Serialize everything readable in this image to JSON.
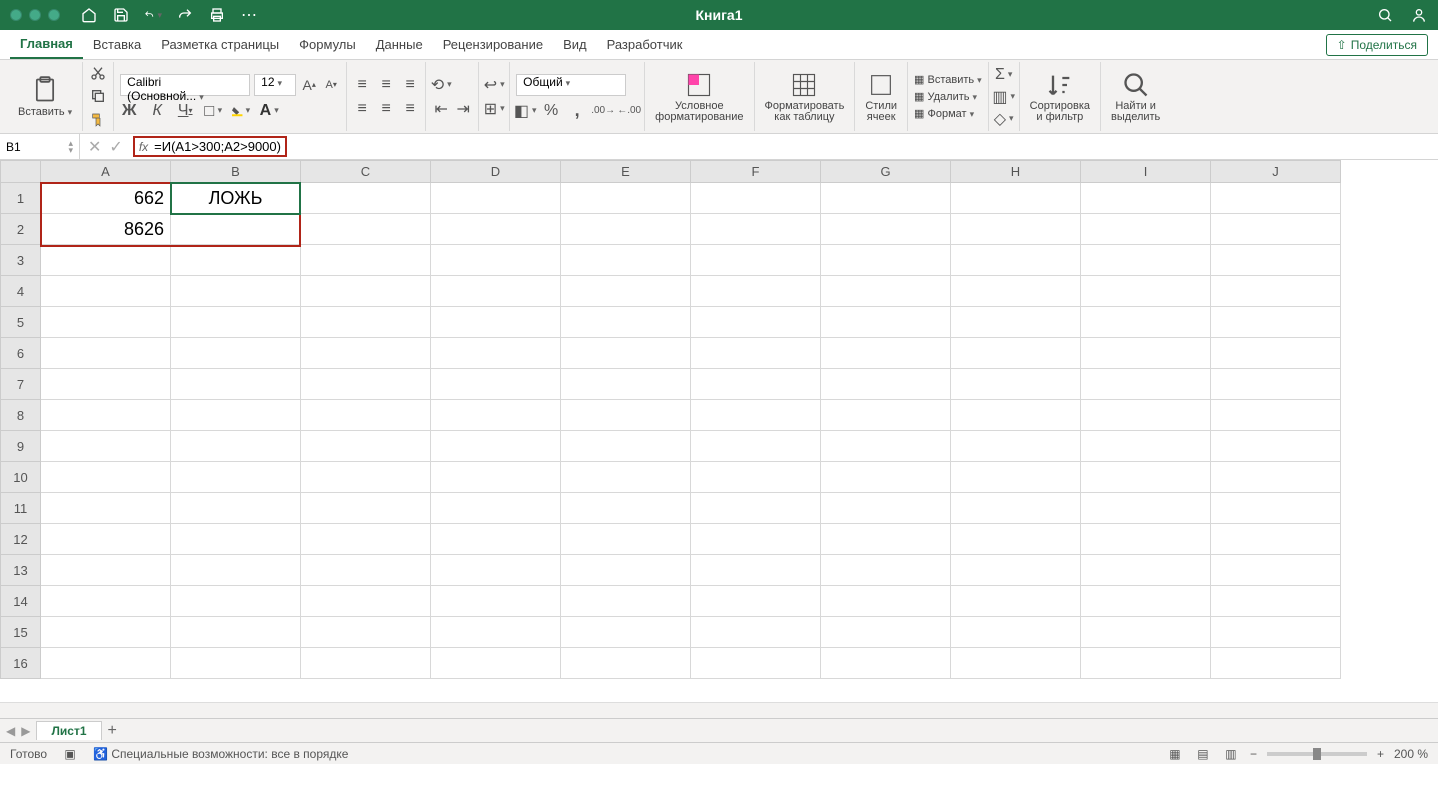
{
  "title": "Книга1",
  "tabs": [
    "Главная",
    "Вставка",
    "Разметка страницы",
    "Формулы",
    "Данные",
    "Рецензирование",
    "Вид",
    "Разработчик"
  ],
  "share": "Поделиться",
  "clipboard": {
    "paste": "Вставить"
  },
  "font": {
    "name": "Calibri (Основной...",
    "size": "12",
    "bold": "Ж",
    "italic": "К",
    "underline": "Ч"
  },
  "number_format": "Общий",
  "cond_fmt": "Условное\nформатирование",
  "fmt_table": "Форматировать\nкак таблицу",
  "cell_styles": "Стили\nячеек",
  "insert": "Вставить",
  "delete": "Удалить",
  "format": "Формат",
  "sort": "Сортировка\nи фильтр",
  "find": "Найти и\nвыделить",
  "namebox": "B1",
  "formula": "=И(A1>300;A2>9000)",
  "columns": [
    "A",
    "B",
    "C",
    "D",
    "E",
    "F",
    "G",
    "H",
    "I",
    "J"
  ],
  "rows": 16,
  "cells": {
    "A1": "662",
    "B1": "ЛОЖЬ",
    "A2": "8626"
  },
  "sheet_tab": "Лист1",
  "status": {
    "ready": "Готово",
    "acc": "Специальные возможности: все в порядке",
    "zoom": "200 %"
  }
}
